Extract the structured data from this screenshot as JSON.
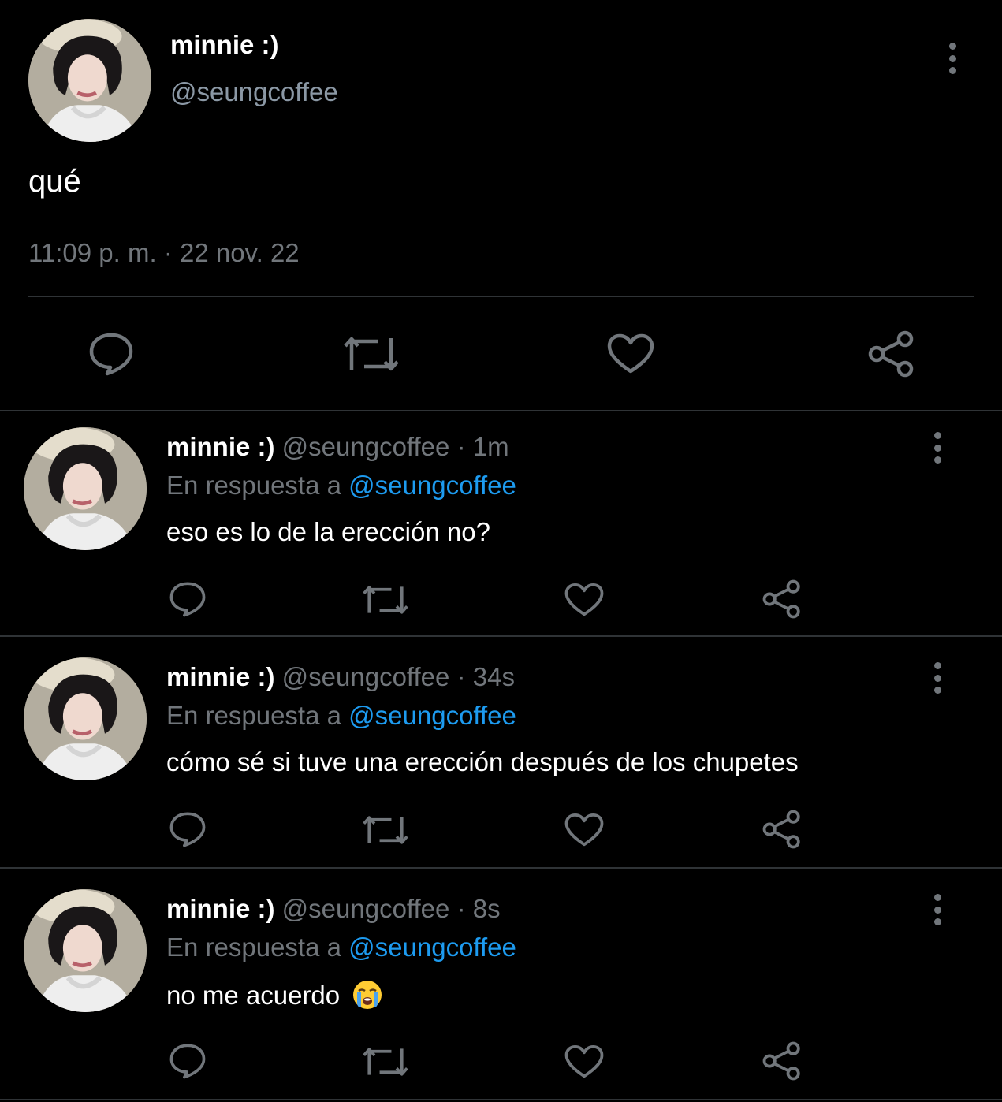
{
  "main_tweet": {
    "name": "minnie :)",
    "handle": "@seungcoffee",
    "text": "qué",
    "timestamp": "11:09 p. m. · 22 nov. 22",
    "actions": [
      "reply-icon",
      "retweet-icon",
      "like-icon",
      "share-icon"
    ]
  },
  "replies": [
    {
      "name": "minnie :)",
      "handle": "@seungcoffee",
      "separator": "·",
      "time": "1m",
      "reply_prefix": "En respuesta a",
      "reply_to": "@seungcoffee",
      "text": "eso es lo de la erección no?"
    },
    {
      "name": "minnie :)",
      "handle": "@seungcoffee",
      "separator": "·",
      "time": "34s",
      "reply_prefix": "En respuesta a",
      "reply_to": "@seungcoffee",
      "text": "cómo sé si tuve una erección después de los chupetes"
    },
    {
      "name": "minnie :)",
      "handle": "@seungcoffee",
      "separator": "·",
      "time": "8s",
      "reply_prefix": "En respuesta a",
      "reply_to": "@seungcoffee",
      "text": "no me acuerdo",
      "emoji": "loudly-crying-face-icon"
    }
  ],
  "colors": {
    "background": "#000000",
    "text": "#ffffff",
    "secondary": "#71767b",
    "link": "#1d9bf0",
    "divider": "#2f3336"
  }
}
